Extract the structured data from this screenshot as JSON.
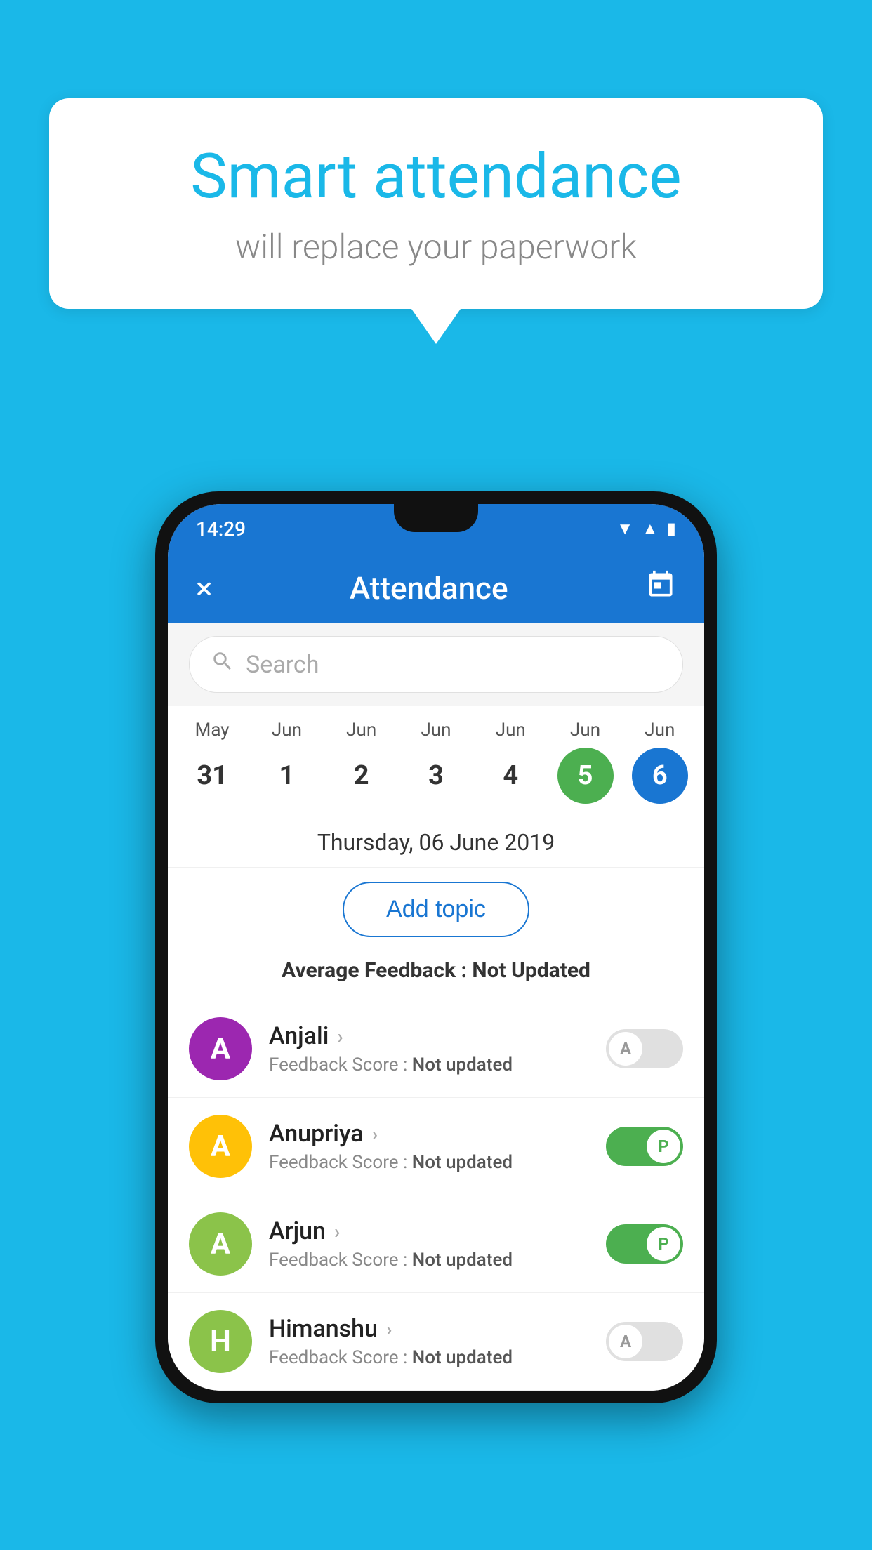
{
  "background_color": "#1ab8e8",
  "speech_bubble": {
    "title": "Smart attendance",
    "subtitle": "will replace your paperwork"
  },
  "status_bar": {
    "time": "14:29",
    "wifi_icon": "wifi",
    "signal_icon": "signal",
    "battery_icon": "battery"
  },
  "app_bar": {
    "title": "Attendance",
    "close_label": "×",
    "calendar_label": "📅"
  },
  "search": {
    "placeholder": "Search"
  },
  "calendar": {
    "days": [
      {
        "month": "May",
        "date": "31",
        "state": "normal"
      },
      {
        "month": "Jun",
        "date": "1",
        "state": "normal"
      },
      {
        "month": "Jun",
        "date": "2",
        "state": "normal"
      },
      {
        "month": "Jun",
        "date": "3",
        "state": "normal"
      },
      {
        "month": "Jun",
        "date": "4",
        "state": "normal"
      },
      {
        "month": "Jun",
        "date": "5",
        "state": "today"
      },
      {
        "month": "Jun",
        "date": "6",
        "state": "selected"
      }
    ]
  },
  "selected_date_label": "Thursday, 06 June 2019",
  "add_topic_label": "Add topic",
  "average_feedback": {
    "label": "Average Feedback : ",
    "value": "Not Updated"
  },
  "students": [
    {
      "name": "Anjali",
      "avatar_letter": "A",
      "avatar_color": "#9c27b0",
      "feedback_label": "Feedback Score : ",
      "feedback_value": "Not updated",
      "attendance": "absent",
      "toggle_letter": "A"
    },
    {
      "name": "Anupriya",
      "avatar_letter": "A",
      "avatar_color": "#ffc107",
      "feedback_label": "Feedback Score : ",
      "feedback_value": "Not updated",
      "attendance": "present",
      "toggle_letter": "P"
    },
    {
      "name": "Arjun",
      "avatar_letter": "A",
      "avatar_color": "#8bc34a",
      "feedback_label": "Feedback Score : ",
      "feedback_value": "Not updated",
      "attendance": "present",
      "toggle_letter": "P"
    },
    {
      "name": "Himanshu",
      "avatar_letter": "H",
      "avatar_color": "#8bc34a",
      "feedback_label": "Feedback Score : ",
      "feedback_value": "Not updated",
      "attendance": "absent",
      "toggle_letter": "A"
    }
  ]
}
